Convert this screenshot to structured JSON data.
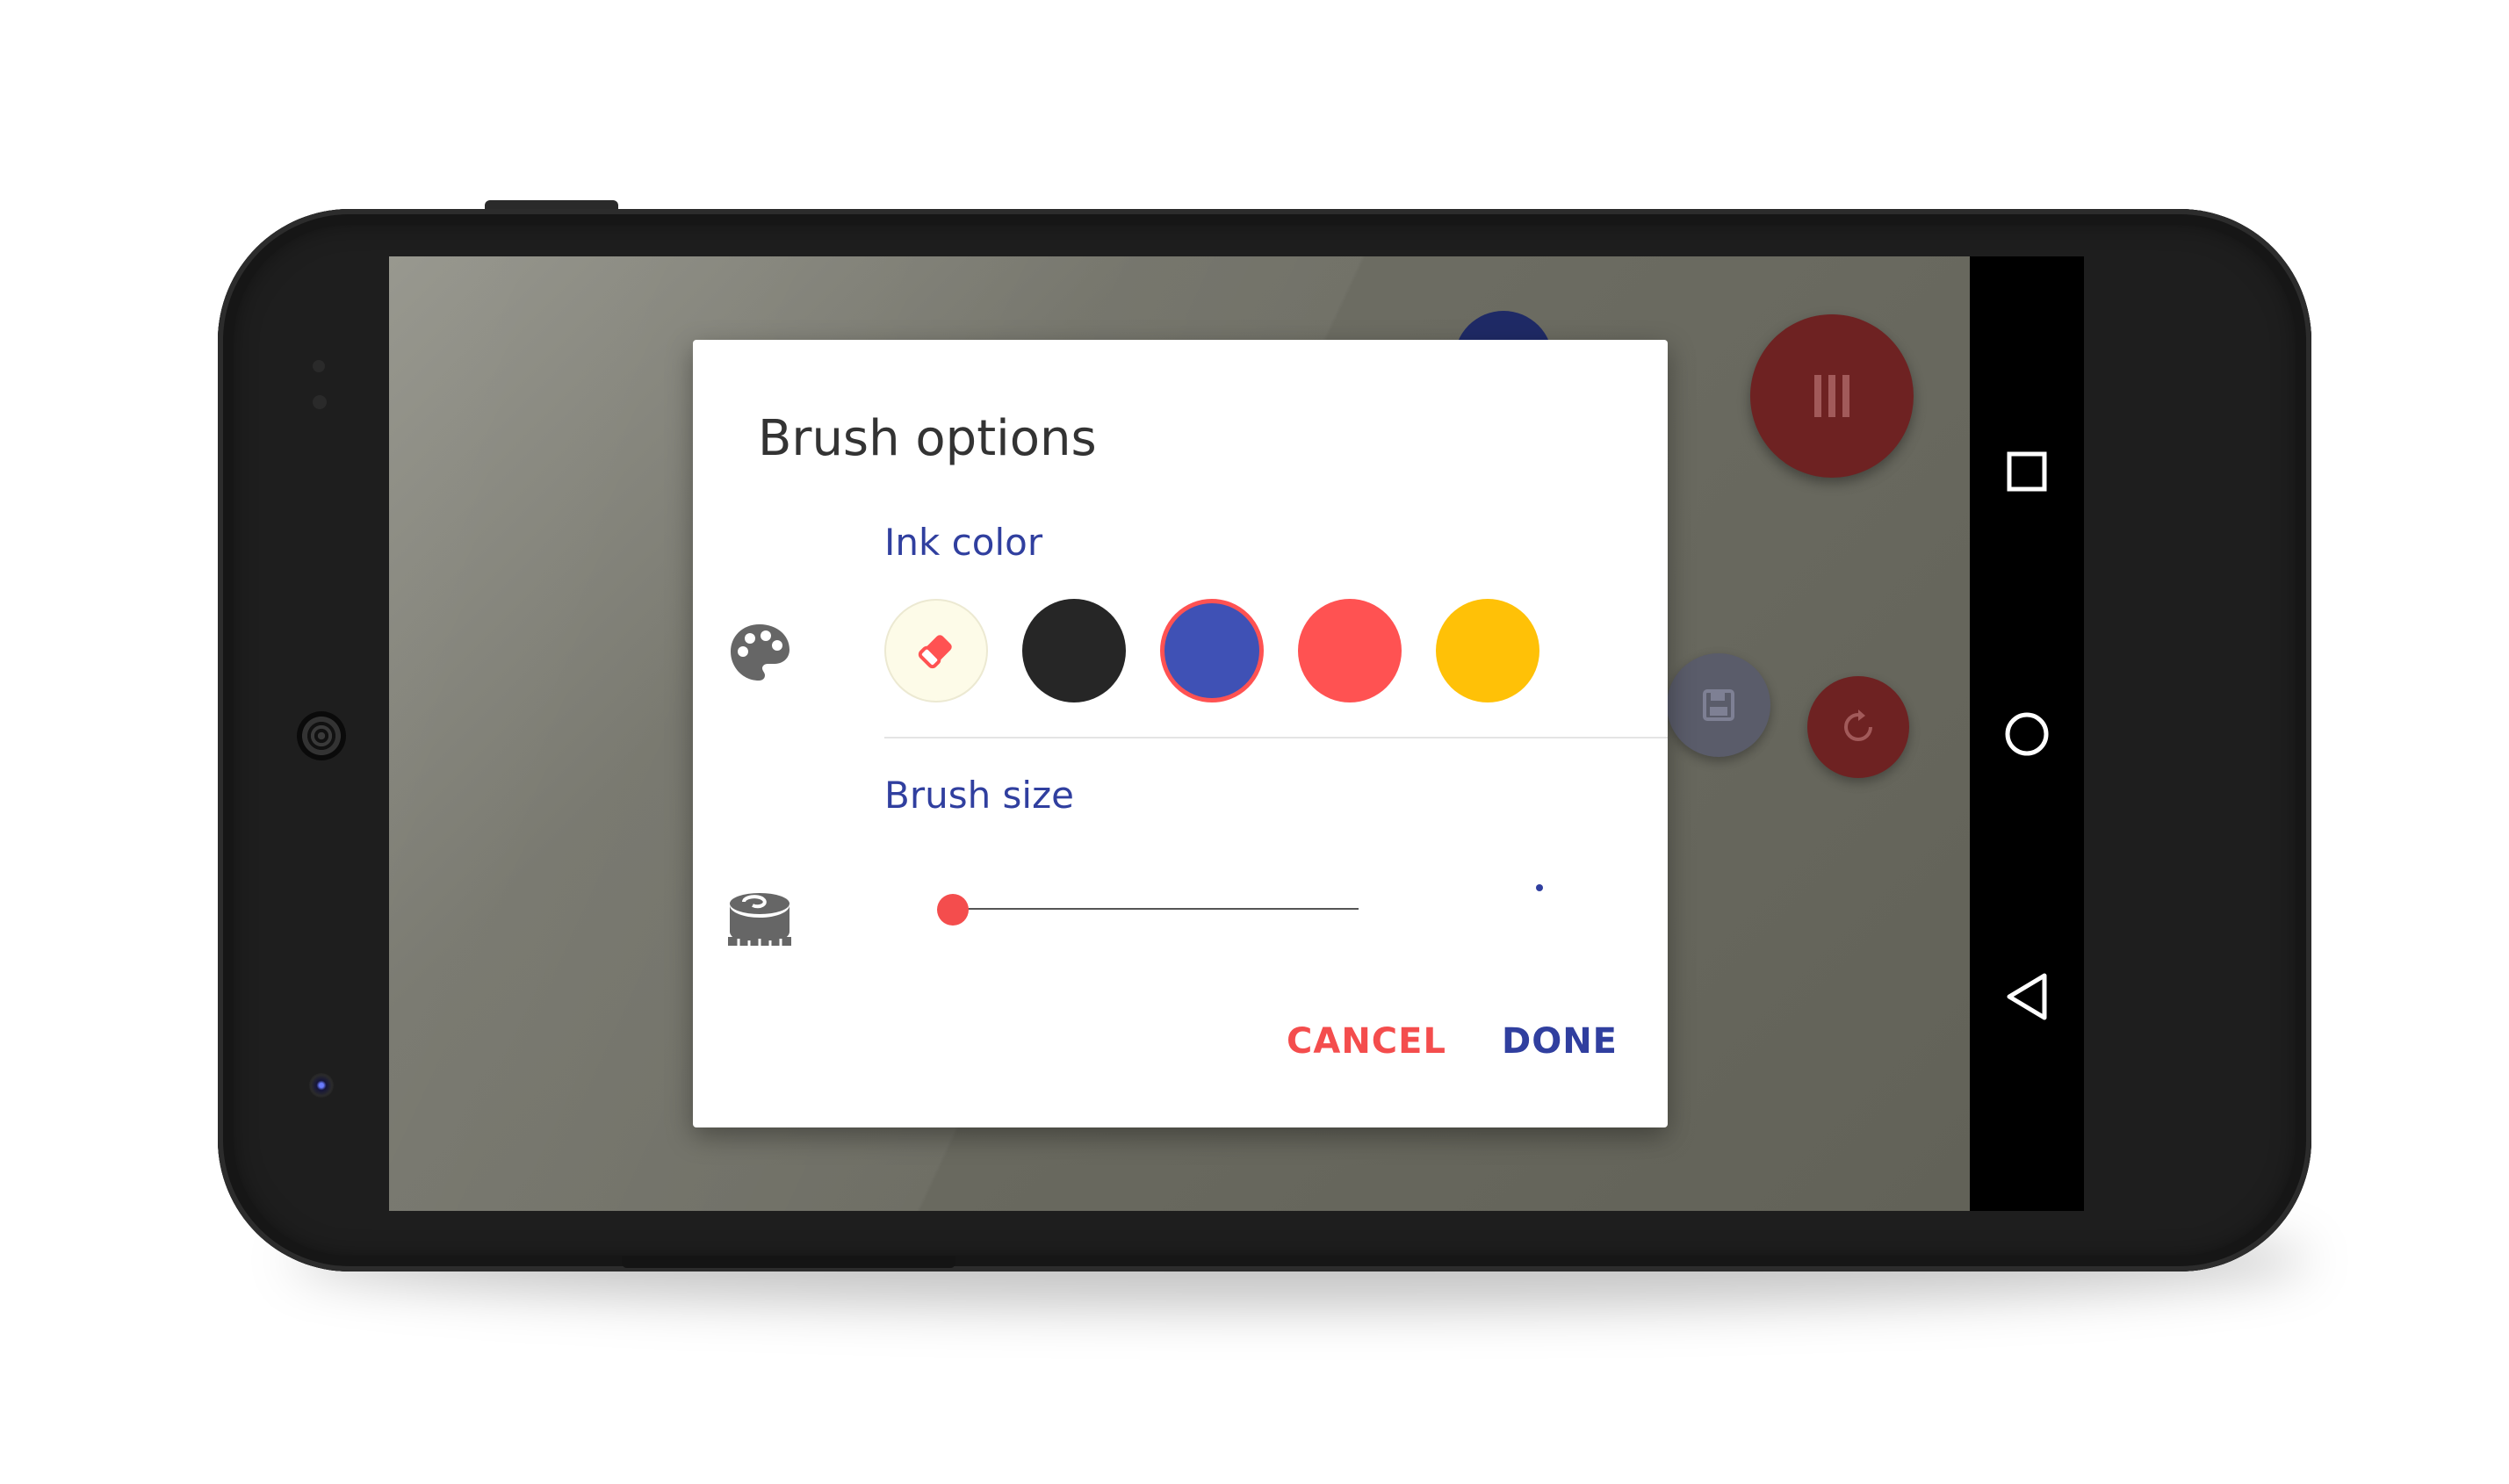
{
  "dialog": {
    "title": "Brush options",
    "ink_color_label": "Ink color",
    "brush_size_label": "Brush size",
    "cancel_label": "CANCEL",
    "done_label": "DONE",
    "ink_colors": [
      {
        "name": "eraser",
        "color": "#fdfbe8",
        "icon": "eraser-icon"
      },
      {
        "name": "black",
        "color": "#262626"
      },
      {
        "name": "blue",
        "color": "#3f51b5",
        "selected": true
      },
      {
        "name": "red",
        "color": "#ff5252"
      },
      {
        "name": "yellow",
        "color": "#ffc107"
      }
    ],
    "brush_size_level": 0.03
  },
  "icons": {
    "palette": "palette-icon",
    "brush_size": "tape-measure-icon",
    "menu": "menu-bars-icon",
    "save": "save-icon",
    "refresh": "refresh-icon"
  },
  "navbar": {
    "buttons": [
      "recent-apps-icon",
      "home-icon",
      "back-icon"
    ]
  },
  "colors": {
    "accent": "#303f9f",
    "cancel": "#f44d4d",
    "fab_red": "#c62828"
  }
}
